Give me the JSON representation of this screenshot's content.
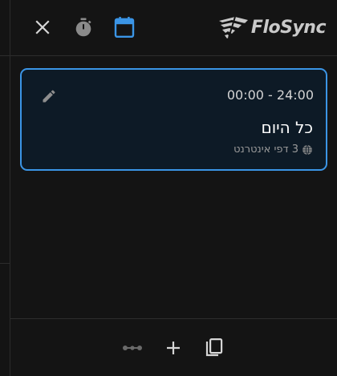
{
  "app": {
    "brand": "FloSync",
    "accent_color": "#3b95e6",
    "header_icons": [
      "close-icon",
      "timer-icon",
      "calendar-icon"
    ]
  },
  "schedule": {
    "time_range": "00:00 - 24:00",
    "title": "כל היום",
    "sites_label": "3 דפי אינטרנט",
    "sites_icon": "globe-icon",
    "edit_icon": "pencil-icon",
    "selected": true
  },
  "footer": {
    "icons": [
      "link-icon",
      "plus-icon",
      "copy-icon"
    ]
  }
}
